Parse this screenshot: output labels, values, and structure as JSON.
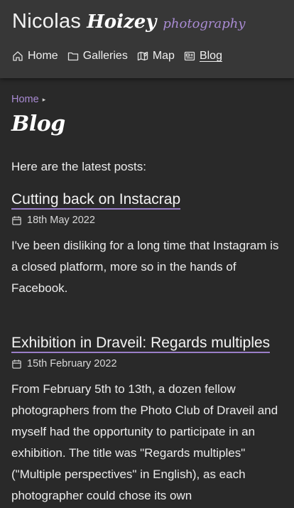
{
  "site": {
    "name_first": "Nicolas",
    "name_last": "Hoizey",
    "tagline": "photography"
  },
  "nav": [
    {
      "label": "Home",
      "icon": "home-icon",
      "active": false
    },
    {
      "label": "Galleries",
      "icon": "folder-icon",
      "active": false
    },
    {
      "label": "Map",
      "icon": "map-icon",
      "active": false
    },
    {
      "label": "Blog",
      "icon": "news-icon",
      "active": true
    }
  ],
  "breadcrumb": {
    "home": "Home",
    "separator": "▸"
  },
  "page": {
    "title": "Blog",
    "intro": "Here are the latest posts:"
  },
  "posts": [
    {
      "title": "Cutting back on Instacrap",
      "date": "18th May 2022",
      "excerpt": "I've been disliking for a long time that Instagram is a closed platform, more so in the hands of Facebook."
    },
    {
      "title": "Exhibition in Draveil: Regards multiples",
      "date": "15th February 2022",
      "excerpt": "From February 5th to 13th, a dozen fellow photographers from the Photo Club of Draveil and myself had the opportunity to participate in an exhibition. The title was \"Regards multiples\" (\"Multiple perspectives\" in English), as each photographer could chose its own"
    }
  ],
  "colors": {
    "background": "#292929",
    "header": "#373737",
    "accent": "#a98bd3",
    "text": "#ececec"
  }
}
